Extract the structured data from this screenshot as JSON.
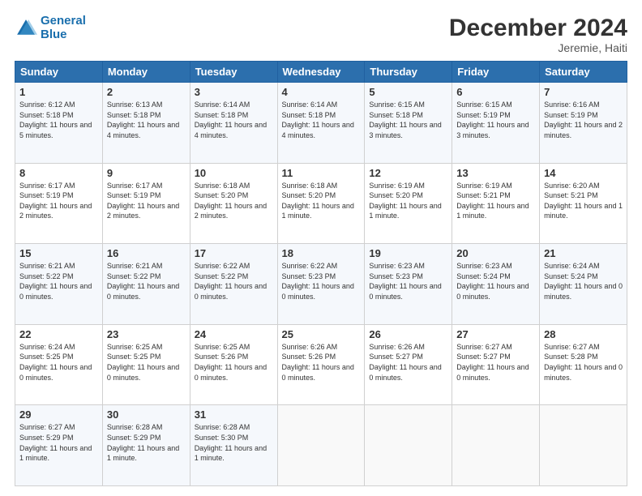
{
  "header": {
    "logo_line1": "General",
    "logo_line2": "Blue",
    "title": "December 2024",
    "subtitle": "Jeremie, Haiti"
  },
  "days_of_week": [
    "Sunday",
    "Monday",
    "Tuesday",
    "Wednesday",
    "Thursday",
    "Friday",
    "Saturday"
  ],
  "weeks": [
    [
      {
        "day": "1",
        "sunrise": "6:12 AM",
        "sunset": "5:18 PM",
        "daylight": "11 hours and 5 minutes."
      },
      {
        "day": "2",
        "sunrise": "6:13 AM",
        "sunset": "5:18 PM",
        "daylight": "11 hours and 4 minutes."
      },
      {
        "day": "3",
        "sunrise": "6:14 AM",
        "sunset": "5:18 PM",
        "daylight": "11 hours and 4 minutes."
      },
      {
        "day": "4",
        "sunrise": "6:14 AM",
        "sunset": "5:18 PM",
        "daylight": "11 hours and 4 minutes."
      },
      {
        "day": "5",
        "sunrise": "6:15 AM",
        "sunset": "5:18 PM",
        "daylight": "11 hours and 3 minutes."
      },
      {
        "day": "6",
        "sunrise": "6:15 AM",
        "sunset": "5:19 PM",
        "daylight": "11 hours and 3 minutes."
      },
      {
        "day": "7",
        "sunrise": "6:16 AM",
        "sunset": "5:19 PM",
        "daylight": "11 hours and 2 minutes."
      }
    ],
    [
      {
        "day": "8",
        "sunrise": "6:17 AM",
        "sunset": "5:19 PM",
        "daylight": "11 hours and 2 minutes."
      },
      {
        "day": "9",
        "sunrise": "6:17 AM",
        "sunset": "5:19 PM",
        "daylight": "11 hours and 2 minutes."
      },
      {
        "day": "10",
        "sunrise": "6:18 AM",
        "sunset": "5:20 PM",
        "daylight": "11 hours and 2 minutes."
      },
      {
        "day": "11",
        "sunrise": "6:18 AM",
        "sunset": "5:20 PM",
        "daylight": "11 hours and 1 minute."
      },
      {
        "day": "12",
        "sunrise": "6:19 AM",
        "sunset": "5:20 PM",
        "daylight": "11 hours and 1 minute."
      },
      {
        "day": "13",
        "sunrise": "6:19 AM",
        "sunset": "5:21 PM",
        "daylight": "11 hours and 1 minute."
      },
      {
        "day": "14",
        "sunrise": "6:20 AM",
        "sunset": "5:21 PM",
        "daylight": "11 hours and 1 minute."
      }
    ],
    [
      {
        "day": "15",
        "sunrise": "6:21 AM",
        "sunset": "5:22 PM",
        "daylight": "11 hours and 0 minutes."
      },
      {
        "day": "16",
        "sunrise": "6:21 AM",
        "sunset": "5:22 PM",
        "daylight": "11 hours and 0 minutes."
      },
      {
        "day": "17",
        "sunrise": "6:22 AM",
        "sunset": "5:22 PM",
        "daylight": "11 hours and 0 minutes."
      },
      {
        "day": "18",
        "sunrise": "6:22 AM",
        "sunset": "5:23 PM",
        "daylight": "11 hours and 0 minutes."
      },
      {
        "day": "19",
        "sunrise": "6:23 AM",
        "sunset": "5:23 PM",
        "daylight": "11 hours and 0 minutes."
      },
      {
        "day": "20",
        "sunrise": "6:23 AM",
        "sunset": "5:24 PM",
        "daylight": "11 hours and 0 minutes."
      },
      {
        "day": "21",
        "sunrise": "6:24 AM",
        "sunset": "5:24 PM",
        "daylight": "11 hours and 0 minutes."
      }
    ],
    [
      {
        "day": "22",
        "sunrise": "6:24 AM",
        "sunset": "5:25 PM",
        "daylight": "11 hours and 0 minutes."
      },
      {
        "day": "23",
        "sunrise": "6:25 AM",
        "sunset": "5:25 PM",
        "daylight": "11 hours and 0 minutes."
      },
      {
        "day": "24",
        "sunrise": "6:25 AM",
        "sunset": "5:26 PM",
        "daylight": "11 hours and 0 minutes."
      },
      {
        "day": "25",
        "sunrise": "6:26 AM",
        "sunset": "5:26 PM",
        "daylight": "11 hours and 0 minutes."
      },
      {
        "day": "26",
        "sunrise": "6:26 AM",
        "sunset": "5:27 PM",
        "daylight": "11 hours and 0 minutes."
      },
      {
        "day": "27",
        "sunrise": "6:27 AM",
        "sunset": "5:27 PM",
        "daylight": "11 hours and 0 minutes."
      },
      {
        "day": "28",
        "sunrise": "6:27 AM",
        "sunset": "5:28 PM",
        "daylight": "11 hours and 0 minutes."
      }
    ],
    [
      {
        "day": "29",
        "sunrise": "6:27 AM",
        "sunset": "5:29 PM",
        "daylight": "11 hours and 1 minute."
      },
      {
        "day": "30",
        "sunrise": "6:28 AM",
        "sunset": "5:29 PM",
        "daylight": "11 hours and 1 minute."
      },
      {
        "day": "31",
        "sunrise": "6:28 AM",
        "sunset": "5:30 PM",
        "daylight": "11 hours and 1 minute."
      },
      null,
      null,
      null,
      null
    ]
  ]
}
